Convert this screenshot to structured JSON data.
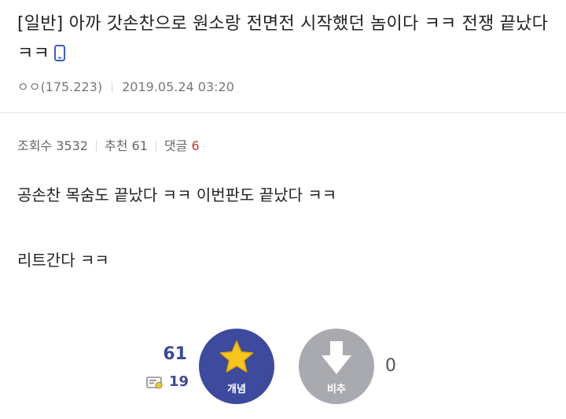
{
  "post": {
    "title": "[일반] 아까 갓손찬으로 원소랑 전면전 시작했던 놈이다 ㅋㅋ 전쟁 끝났다 ㅋㅋ",
    "author": "ㅇㅇ(175.223)",
    "date": "2019.05.24 03:20",
    "mobile_icon": "mobile-phone-icon"
  },
  "stats": {
    "views_label": "조회수",
    "views": "3532",
    "recommend_label": "추천",
    "recommend": "61",
    "comments_label": "댓글",
    "comments": "6"
  },
  "content": {
    "lines": [
      "공손찬 목숨도 끝났다 ㅋㅋ 이번판도 끝났다 ㅋㅋ",
      "리트간다 ㅋㅋ"
    ]
  },
  "vote": {
    "up_count": "61",
    "fixed_count": "19",
    "up_label": "개념",
    "down_label": "비추",
    "down_count": "0",
    "up_icon": "star-icon",
    "down_icon": "down-arrow-icon",
    "fixed_icon": "fixed-user-icon",
    "colors": {
      "up": "#3d4a9e",
      "down": "#a9aab0",
      "star": "#f7c51e",
      "count": "#3b4a9a",
      "comment_count": "#c0392b"
    }
  }
}
